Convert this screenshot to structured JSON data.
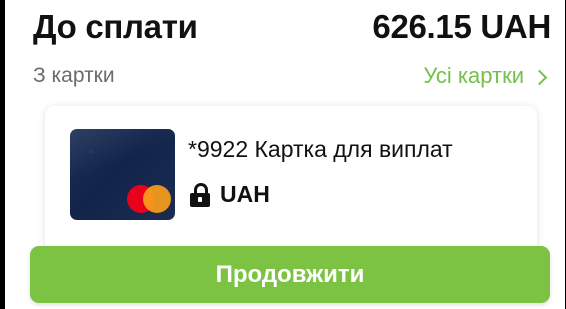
{
  "payment": {
    "title": "До сплати",
    "amount": "626.15 UAH"
  },
  "source": {
    "label": "З картки",
    "all_cards_link": "Усі картки"
  },
  "card": {
    "name": "*9922 Картка для виплат",
    "currency": "UAH",
    "brand_icon": "mastercard-icon"
  },
  "actions": {
    "continue_label": "Продовжити"
  },
  "colors": {
    "accent": "#7cc243",
    "link": "#74c14a"
  }
}
